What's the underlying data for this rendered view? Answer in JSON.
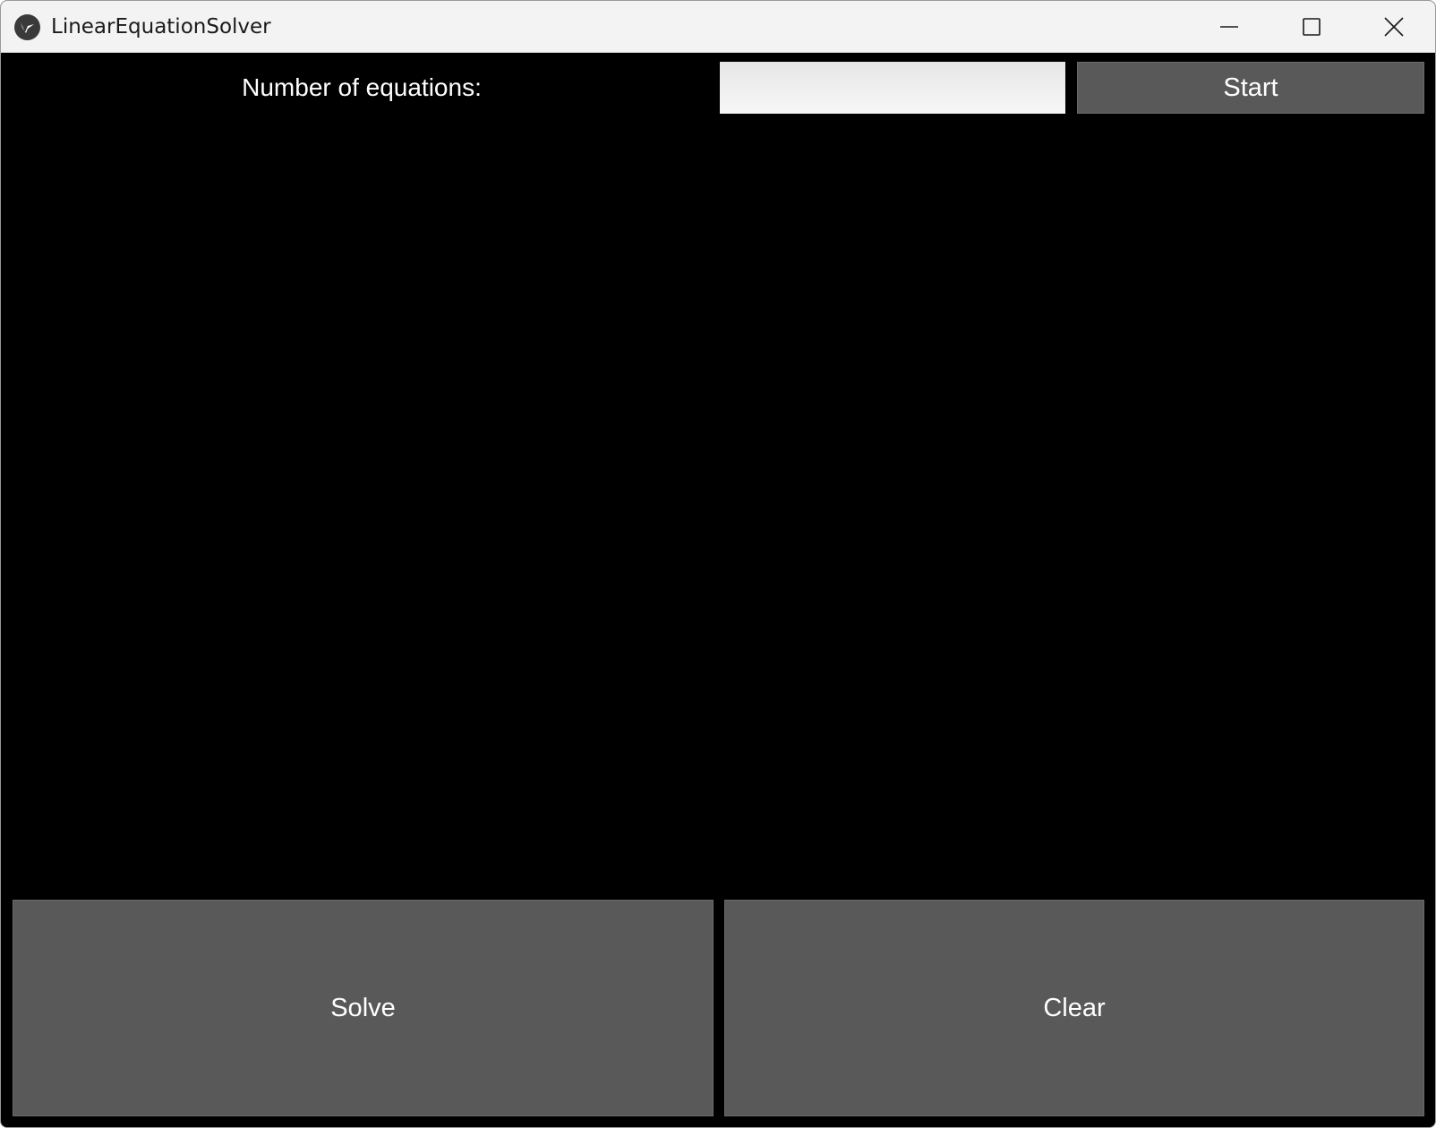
{
  "window": {
    "title": "LinearEquationSolver",
    "icon": "kivy-logo-icon",
    "controls": [
      "minimize-icon",
      "maximize-icon",
      "close-icon"
    ]
  },
  "form": {
    "num_equations_label": "Number of equations:",
    "num_equations_value": "",
    "start_label": "Start"
  },
  "actions": {
    "solve_label": "Solve",
    "clear_label": "Clear"
  },
  "colors": {
    "background": "#000000",
    "button": "#595959",
    "button_text": "#ffffff",
    "titlebar": "#f3f3f3"
  }
}
